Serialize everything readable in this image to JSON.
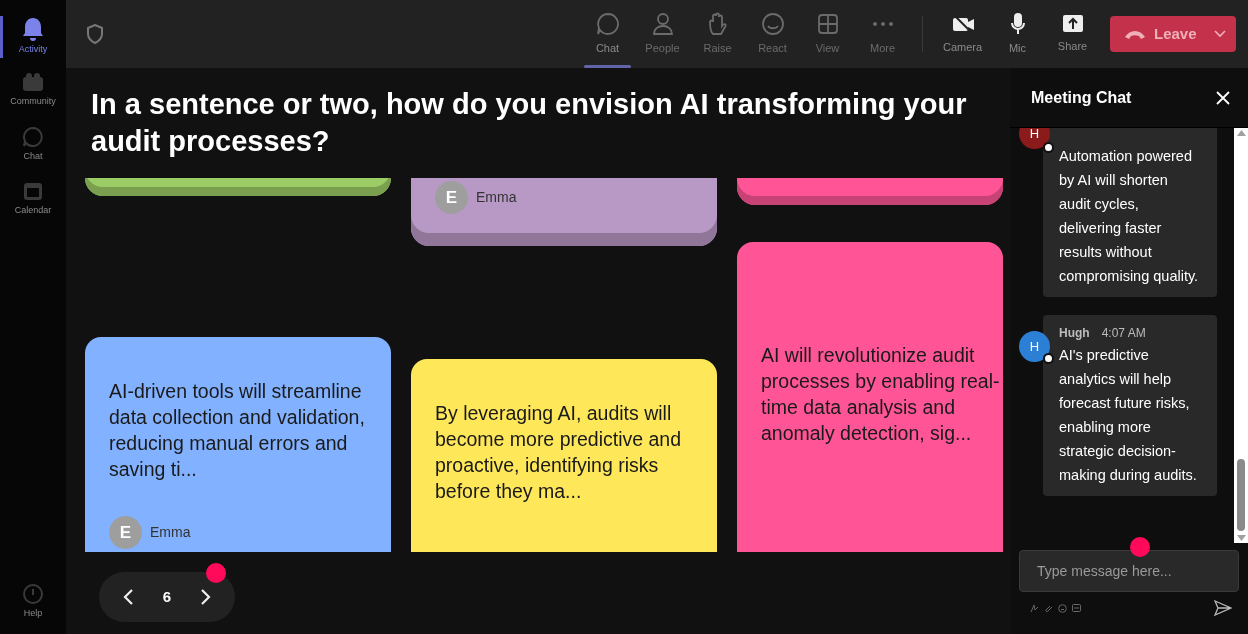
{
  "sidebar": {
    "items": [
      {
        "label": "Activity",
        "selected": true
      },
      {
        "label": "Community",
        "selected": false
      },
      {
        "label": "Chat",
        "selected": false
      },
      {
        "label": "Calendar",
        "selected": false
      }
    ],
    "help": {
      "label": "Help"
    }
  },
  "toolbar": {
    "items": [
      {
        "label": "Chat",
        "selected": true
      },
      {
        "label": "People",
        "selected": false
      },
      {
        "label": "Raise",
        "selected": false
      },
      {
        "label": "React",
        "selected": false
      },
      {
        "label": "View",
        "selected": false
      },
      {
        "label": "More",
        "selected": false
      }
    ],
    "media": [
      {
        "label": "Camera"
      },
      {
        "label": "Mic"
      },
      {
        "label": "Share"
      }
    ],
    "leave": {
      "label": "Leave"
    }
  },
  "question": "In a sentence or two, how do you envision AI transforming your audit processes?",
  "columns": [
    {
      "cards": [
        {
          "kind": "tail",
          "color": "#9ccc65"
        },
        {
          "kind": "note",
          "color": "#82b1ff",
          "text": "AI-driven tools will streamline data collection and validation, reducing manual errors and saving ti...",
          "author": {
            "initial": "E",
            "name": "Emma"
          }
        }
      ]
    },
    {
      "cards": [
        {
          "kind": "tail",
          "color": "#b899c6",
          "author": {
            "initial": "E",
            "name": "Emma"
          }
        },
        {
          "kind": "note",
          "color": "#ffe75a",
          "text": "By leveraging AI, audits will become more predictive and proactive, identifying risks before they ma..."
        }
      ]
    },
    {
      "cards": [
        {
          "kind": "tail",
          "color": "#ff5596"
        },
        {
          "kind": "note",
          "color": "#ff5596",
          "text": "AI will revolutionize audit processes by enabling real-time data analysis and anomaly detection, sig..."
        }
      ]
    }
  ],
  "pager": {
    "page": "6"
  },
  "chat": {
    "title": "Meeting Chat",
    "messages": [
      {
        "initial": "H",
        "color": "#8b1a1a",
        "text": "Automation powered by AI will shorten audit cycles, delivering faster results without compromising quality."
      },
      {
        "initial": "H",
        "color": "#2b7fd4",
        "name": "Hugh",
        "time": "4:07 AM",
        "text": "AI's predictive analytics will help forecast future risks, enabling more strategic decision-making during audits."
      }
    ],
    "input": {
      "placeholder": "Type message here..."
    }
  }
}
